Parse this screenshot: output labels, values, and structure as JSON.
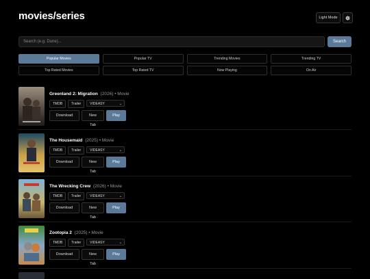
{
  "header": {
    "title": "movies/series",
    "light_mode_label": "Light Mode",
    "settings_icon": "gear-icon"
  },
  "search": {
    "placeholder": "Search (e.g. Dune)...",
    "button_label": "Search"
  },
  "tabs": [
    {
      "label": "Popular Movies",
      "active": true
    },
    {
      "label": "Popular TV",
      "active": false
    },
    {
      "label": "Trending Movies",
      "active": false
    },
    {
      "label": "Trending TV",
      "active": false
    },
    {
      "label": "Top Rated Movies",
      "active": false
    },
    {
      "label": "Top Rated TV",
      "active": false
    },
    {
      "label": "Now Playing",
      "active": false
    },
    {
      "label": "On Air",
      "active": false
    }
  ],
  "items": [
    {
      "name": "Greenland 2: Migration",
      "year": "(2026)",
      "type": "• Movie",
      "tmdb": "TMDB",
      "trailer": "Trailer",
      "source": "VIDEASY",
      "download": "Download",
      "new_tab": "New Tab",
      "play": "Play"
    },
    {
      "name": "The Housemaid",
      "year": "(2025)",
      "type": "• Movie",
      "tmdb": "TMDB",
      "trailer": "Trailer",
      "source": "VIDEASY",
      "download": "Download",
      "new_tab": "New Tab",
      "play": "Play"
    },
    {
      "name": "The Wrecking Crew",
      "year": "(2026)",
      "type": "• Movie",
      "tmdb": "TMDB",
      "trailer": "Trailer",
      "source": "VIDEASY",
      "download": "Download",
      "new_tab": "New Tab",
      "play": "Play"
    },
    {
      "name": "Zootopia 2",
      "year": "(2025)",
      "type": "• Movie",
      "tmdb": "TMDB",
      "trailer": "Trailer",
      "source": "VIDEASY",
      "download": "Download",
      "new_tab": "New Tab",
      "play": "Play"
    }
  ],
  "colors": {
    "accent": "#5b7a9a",
    "background": "#000000"
  }
}
